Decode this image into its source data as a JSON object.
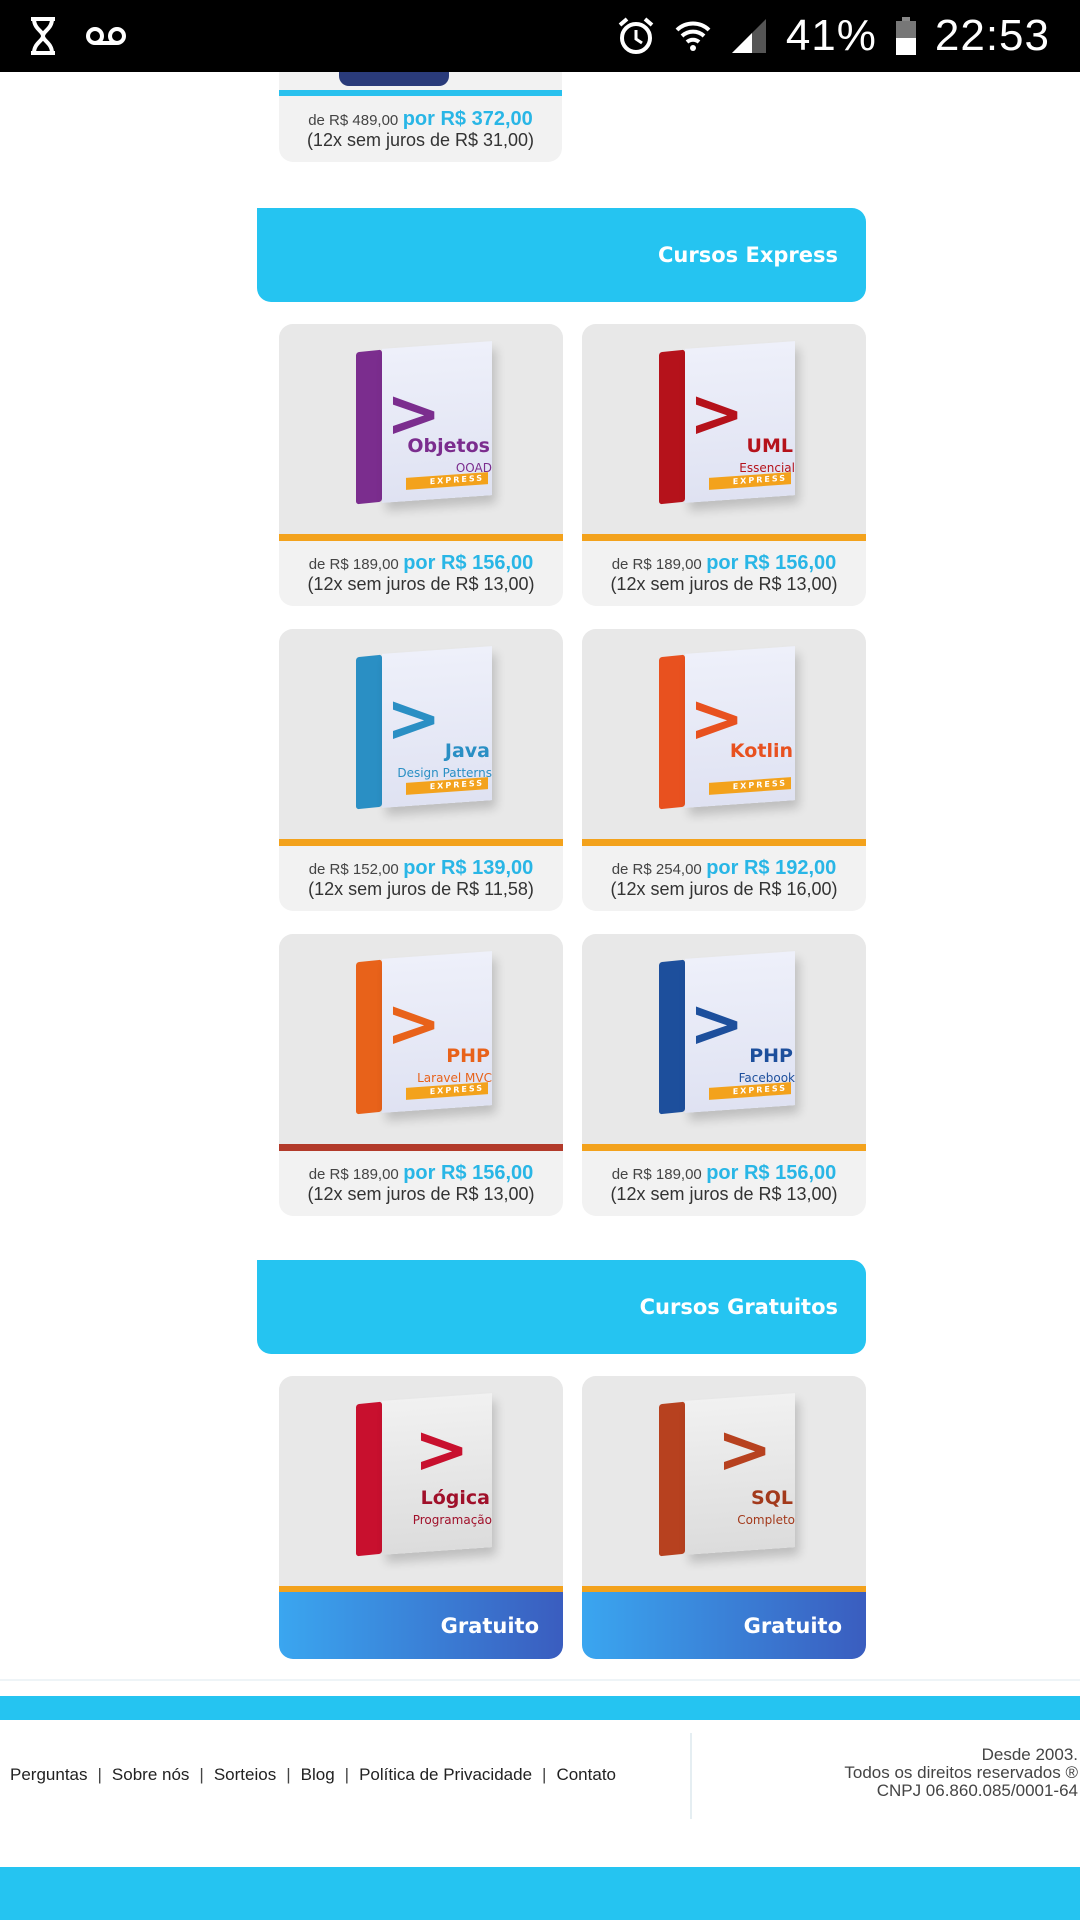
{
  "status_bar": {
    "battery_percent": "41%",
    "time": "22:53",
    "icons": [
      "hourglass-icon",
      "voicemail-icon",
      "alarm-icon",
      "wifi-icon",
      "signal-icon",
      "battery-icon"
    ]
  },
  "top_card": {
    "old_price": "de R$ 489,00",
    "new_price": "por R$ 372,00",
    "installment": "(12x sem juros de R$ 31,00)"
  },
  "sections": {
    "express_title": "Cursos Express",
    "free_title": "Cursos Gratuitos"
  },
  "express_courses": [
    {
      "title": "Objetos",
      "subtitle": "OOAD",
      "badge": "EXPRESS",
      "old_price": "de R$ 189,00",
      "new_price": "por R$ 156,00",
      "installment": "(12x sem juros de R$ 13,00)",
      "color": "#7b2d8e",
      "accent": "#f3a21c"
    },
    {
      "title": "UML",
      "subtitle": "Essencial",
      "badge": "EXPRESS",
      "old_price": "de R$ 189,00",
      "new_price": "por R$ 156,00",
      "installment": "(12x sem juros de R$ 13,00)",
      "color": "#b5121b",
      "accent": "#f3a21c"
    },
    {
      "title": "Java",
      "subtitle": "Design Patterns",
      "badge": "EXPRESS",
      "old_price": "de R$ 152,00",
      "new_price": "por R$ 139,00",
      "installment": "(12x sem juros de R$ 11,58)",
      "color": "#2a8fc4",
      "accent": "#f3a21c"
    },
    {
      "title": "Kotlin",
      "subtitle": "",
      "badge": "EXPRESS",
      "old_price": "de R$ 254,00",
      "new_price": "por R$ 192,00",
      "installment": "(12x sem juros de R$ 16,00)",
      "color": "#e8511f",
      "accent": "#f3a21c"
    },
    {
      "title": "PHP",
      "subtitle": "Laravel MVC",
      "badge": "EXPRESS",
      "old_price": "de R$ 189,00",
      "new_price": "por R$ 156,00",
      "installment": "(12x sem juros de R$ 13,00)",
      "color": "#e8621a",
      "accent": "#b23a2a"
    },
    {
      "title": "PHP",
      "subtitle": "Facebook",
      "badge": "EXPRESS",
      "old_price": "de R$ 189,00",
      "new_price": "por R$ 156,00",
      "installment": "(12x sem juros de R$ 13,00)",
      "color": "#1d4f9c",
      "accent": "#f3a21c"
    }
  ],
  "free_courses": [
    {
      "title": "Lógica",
      "subtitle": "Programação",
      "button": "Gratuito",
      "color": "#c8102e"
    },
    {
      "title": "SQL",
      "subtitle": "Completo",
      "button": "Gratuito",
      "color": "#b7411f"
    }
  ],
  "footer": {
    "links": [
      "Perguntas",
      "Sobre nós",
      "Sorteios",
      "Blog",
      "Política de Privacidade",
      "Contato"
    ],
    "separator": "|",
    "since": "Desde 2003.",
    "rights": "Todos os direitos reservados ®",
    "cnpj": "CNPJ 06.860.085/0001-64"
  }
}
